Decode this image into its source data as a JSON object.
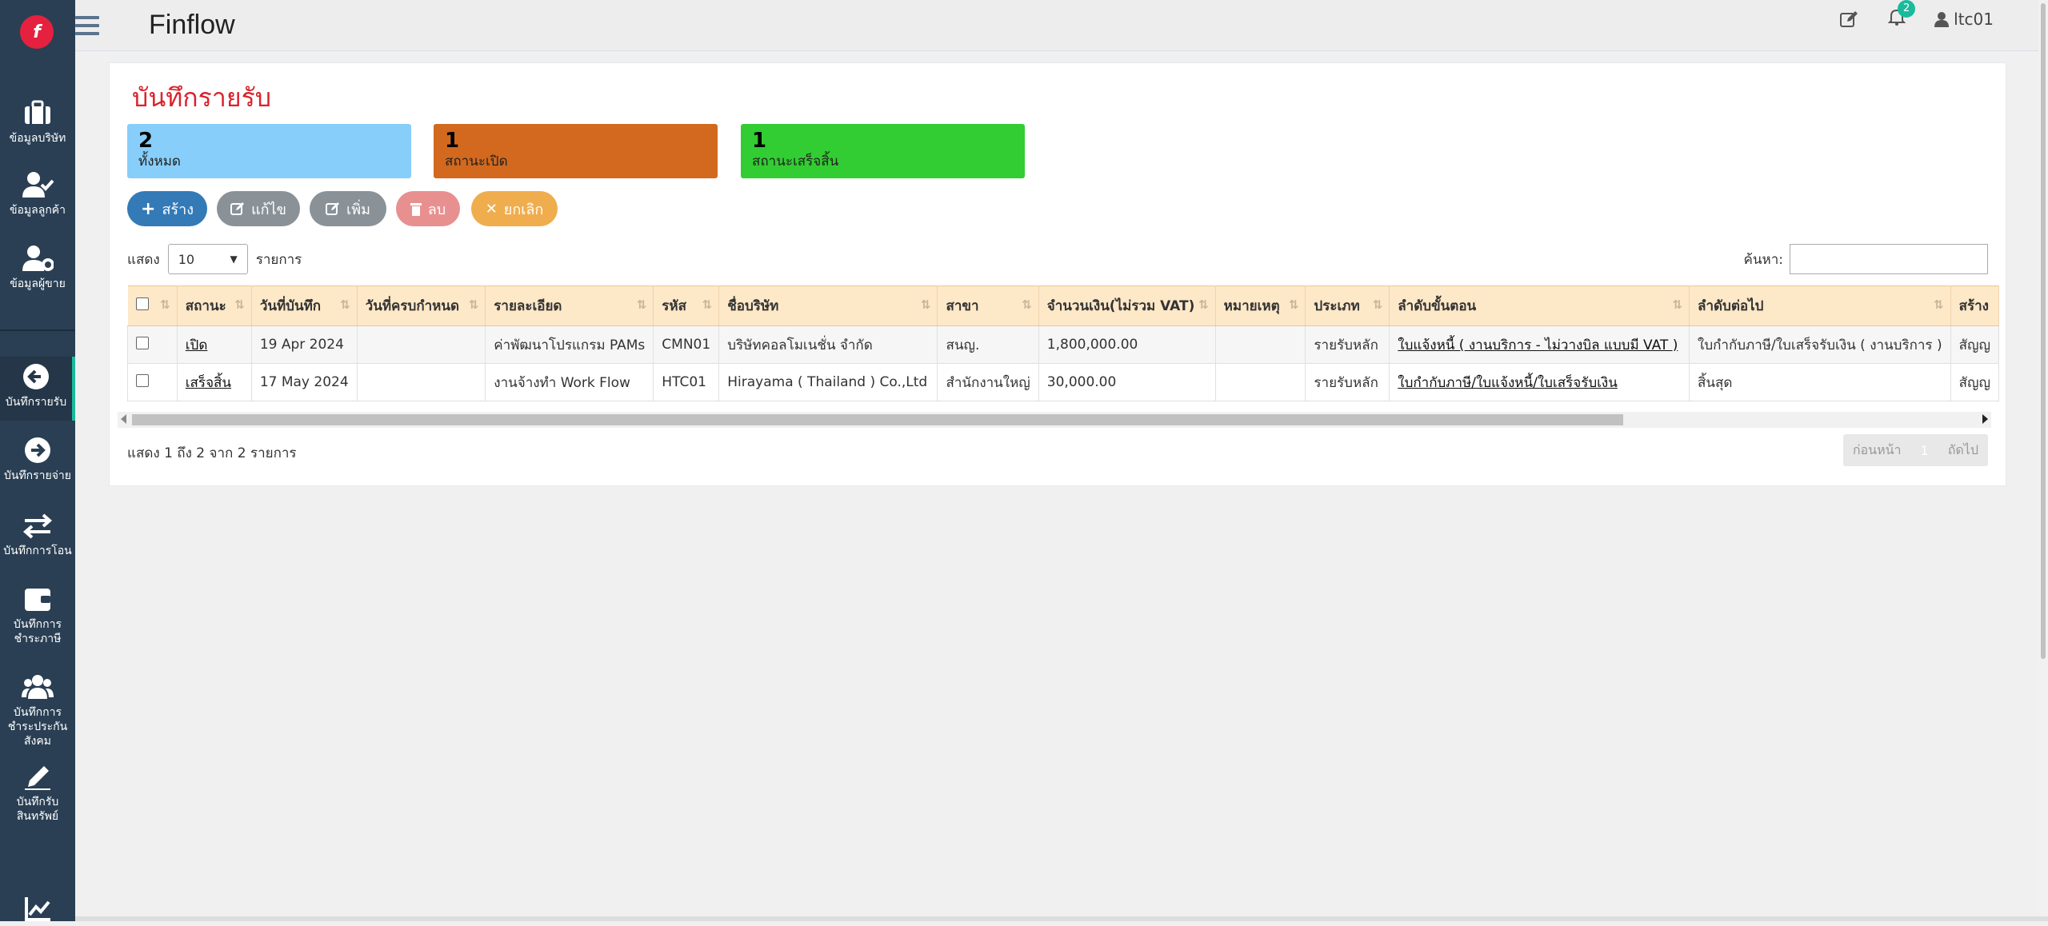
{
  "app": {
    "title": "Finflow",
    "logo_letter": "f"
  },
  "sidebar": {
    "items": [
      {
        "label": "ข้อมูลบริษัท",
        "icon": "briefcase-icon"
      },
      {
        "label": "ข้อมูลลูกค้า",
        "icon": "user-check-icon"
      },
      {
        "label": "ข้อมูลผู้ขาย",
        "icon": "user-gear-icon"
      },
      {
        "label": "บันทึกรายรับ",
        "icon": "arrow-left-circle-icon",
        "active": true
      },
      {
        "label": "บันทึกรายจ่าย",
        "icon": "arrow-right-circle-icon"
      },
      {
        "label": "บันทึกการโอน",
        "icon": "transfer-arrows-icon"
      },
      {
        "label": "บันทึกการชำระภาษี",
        "icon": "wallet-icon"
      },
      {
        "label": "บันทึกการชำระประกันสังคม",
        "icon": "users-group-icon"
      },
      {
        "label": "บันทึกรับสินทรัพย์",
        "icon": "pencil-icon"
      },
      {
        "label": "",
        "icon": "chart-line-icon"
      }
    ]
  },
  "header": {
    "notif_count": "2",
    "user": "ltc01"
  },
  "page": {
    "title": "บันทึกรายรับ",
    "stats": [
      {
        "num": "2",
        "label": "ทั้งหมด",
        "color": "#87cefa"
      },
      {
        "num": "1",
        "label": "สถานะเปิด",
        "color": "#d2691e"
      },
      {
        "num": "1",
        "label": "สถานะเสร็จสิ้น",
        "color": "#32cd32"
      }
    ],
    "buttons": {
      "create": "สร้าง",
      "edit": "แก้ไข",
      "add": "เพิ่ม",
      "delete": "ลบ",
      "cancel": "ยกเลิก"
    },
    "length": {
      "show": "แสดง",
      "value": "10",
      "unit": "รายการ"
    },
    "search_label": "ค้นหา:",
    "table": {
      "columns": [
        "",
        "สถานะ",
        "วันที่บันทึก",
        "วันที่ครบกำหนด",
        "รายละเอียด",
        "รหัส",
        "ชื่อบริษัท",
        "สาขา",
        "จำนวนเงิน(ไม่รวม VAT)",
        "หมายเหตุ",
        "ประเภท",
        "ลำดับขั้นตอน",
        "ลำดับต่อไป",
        "สร้าง"
      ],
      "rows": [
        [
          "",
          "เปิด",
          "19 Apr 2024",
          "",
          "ค่าพัฒนาโปรแกรม PAMs",
          "CMN01",
          "บริษัทคอลโมเนชั่น จำกัด",
          "สนญ.",
          "1,800,000.00",
          "",
          "รายรับหลัก",
          "ใบแจ้งหนี้ ( งานบริการ - ไม่วางบิล แบบมี VAT )",
          "ใบกำกับภาษี/ใบเสร็จรับเงิน ( งานบริการ )",
          "สัญญ"
        ],
        [
          "",
          "เสร็จสิ้น",
          "17 May 2024",
          "",
          "งานจ้างทำ Work Flow",
          "HTC01",
          "Hirayama ( Thailand ) Co.,Ltd",
          "สำนักงานใหญ่",
          "30,000.00",
          "",
          "รายรับหลัก",
          "ใบกำกับภาษี/ใบแจ้งหนี้/ใบเสร็จรับเงิน",
          "สิ้นสุด",
          "สัญญ"
        ]
      ]
    },
    "info": "แสดง 1 ถึง 2 จาก 2 รายการ",
    "pager": {
      "prev": "ก่อนหน้า",
      "current": "1",
      "next": "ถัดไป"
    }
  }
}
